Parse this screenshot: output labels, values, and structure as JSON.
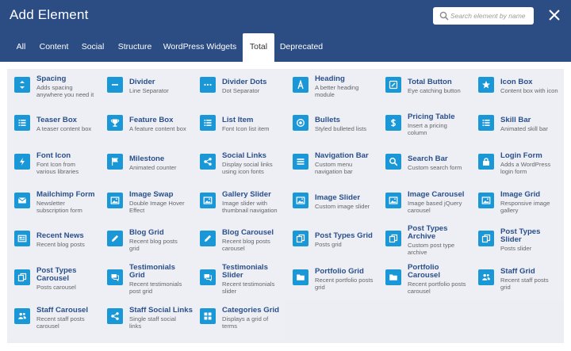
{
  "window": {
    "title": "Add Element"
  },
  "search": {
    "placeholder": "Search element by name"
  },
  "tabs": [
    {
      "label": "All",
      "active": false
    },
    {
      "label": "Content",
      "active": false
    },
    {
      "label": "Social",
      "active": false
    },
    {
      "label": "Structure",
      "active": false
    },
    {
      "label": "WordPress Widgets",
      "active": false
    },
    {
      "label": "Total",
      "active": true
    },
    {
      "label": "Deprecated",
      "active": false
    }
  ],
  "colors": {
    "header": "#2c4c84",
    "accent": "#1a97d6",
    "title_text": "#2a4f8a",
    "card_bg": "#edeff5"
  },
  "elements": [
    {
      "title": [
        "Spacing"
      ],
      "desc": [
        "Adds spacing",
        "anywhere you need it"
      ],
      "icon": "spacing-icon"
    },
    {
      "title": [
        "Divider"
      ],
      "desc": [
        "Line Separator"
      ],
      "icon": "divider-icon"
    },
    {
      "title": [
        "Divider Dots"
      ],
      "desc": [
        "Dot Separator"
      ],
      "icon": "divider-dots-icon"
    },
    {
      "title": [
        "Heading"
      ],
      "desc": [
        "A better heading",
        "module"
      ],
      "icon": "heading-icon"
    },
    {
      "title": [
        "Total Button"
      ],
      "desc": [
        "Eye catching button"
      ],
      "icon": "button-icon"
    },
    {
      "title": [
        "Icon Box"
      ],
      "desc": [
        "Content box with icon"
      ],
      "icon": "star-icon"
    },
    {
      "title": [
        "Teaser Box"
      ],
      "desc": [
        "A teaser content box"
      ],
      "icon": "list-icon"
    },
    {
      "title": [
        "Feature Box"
      ],
      "desc": [
        "A feature content box"
      ],
      "icon": "trophy-icon"
    },
    {
      "title": [
        "List Item"
      ],
      "desc": [
        "Font Icon list item"
      ],
      "icon": "list-icon"
    },
    {
      "title": [
        "Bullets"
      ],
      "desc": [
        "Styled bulleted lists"
      ],
      "icon": "bullet-icon"
    },
    {
      "title": [
        "Pricing Table"
      ],
      "desc": [
        "Insert a pricing",
        "column"
      ],
      "icon": "dollar-icon"
    },
    {
      "title": [
        "Skill Bar"
      ],
      "desc": [
        "Animated skill bar"
      ],
      "icon": "list-icon"
    },
    {
      "title": [
        "Font Icon"
      ],
      "desc": [
        "Font Icon from",
        "various libraries"
      ],
      "icon": "bolt-icon"
    },
    {
      "title": [
        "Milestone"
      ],
      "desc": [
        "Animated counter"
      ],
      "icon": "flag-icon"
    },
    {
      "title": [
        "Social Links"
      ],
      "desc": [
        "Display social links",
        "using icon fonts"
      ],
      "icon": "share-icon"
    },
    {
      "title": [
        "Navigation Bar"
      ],
      "desc": [
        "Custom menu",
        "navigation bar"
      ],
      "icon": "menu-icon"
    },
    {
      "title": [
        "Search Bar"
      ],
      "desc": [
        "Custom search form"
      ],
      "icon": "search-icon"
    },
    {
      "title": [
        "Login Form"
      ],
      "desc": [
        "Adds a WordPress",
        "login form"
      ],
      "icon": "lock-icon"
    },
    {
      "title": [
        "Mailchimp Form"
      ],
      "desc": [
        "Newsletter",
        "subscription form"
      ],
      "icon": "envelope-icon"
    },
    {
      "title": [
        "Image Swap"
      ],
      "desc": [
        "Double Image Hover",
        "Effect"
      ],
      "icon": "image-icon"
    },
    {
      "title": [
        "Gallery Slider"
      ],
      "desc": [
        "Image slider with",
        "thumbnail navigation"
      ],
      "icon": "image-icon"
    },
    {
      "title": [
        "Image Slider"
      ],
      "desc": [
        "Custom image slider"
      ],
      "icon": "image-icon"
    },
    {
      "title": [
        "Image Carousel"
      ],
      "desc": [
        "Image based jQuery",
        "carousel"
      ],
      "icon": "image-icon"
    },
    {
      "title": [
        "Image Grid"
      ],
      "desc": [
        "Responsive image",
        "gallery"
      ],
      "icon": "image-icon"
    },
    {
      "title": [
        "Recent News"
      ],
      "desc": [
        "Recent blog posts"
      ],
      "icon": "newspaper-icon"
    },
    {
      "title": [
        "Blog Grid"
      ],
      "desc": [
        "Recent blog posts",
        "grid"
      ],
      "icon": "pencil-icon"
    },
    {
      "title": [
        "Blog Carousel"
      ],
      "desc": [
        "Recent blog posts",
        "carousel"
      ],
      "icon": "pencil-icon"
    },
    {
      "title": [
        "Post Types Grid"
      ],
      "desc": [
        "Posts grid"
      ],
      "icon": "copy-icon"
    },
    {
      "title": [
        "Post Types",
        "Archive"
      ],
      "desc": [
        "Custom post type",
        "archive"
      ],
      "icon": "copy-icon"
    },
    {
      "title": [
        "Post Types",
        "Slider"
      ],
      "desc": [
        "Posts slider"
      ],
      "icon": "copy-icon"
    },
    {
      "title": [
        "Post Types",
        "Carousel"
      ],
      "desc": [
        "Posts carousel"
      ],
      "icon": "copy-icon"
    },
    {
      "title": [
        "Testimonials",
        "Grid"
      ],
      "desc": [
        "Recent testimonials",
        "post grid"
      ],
      "icon": "comments-icon"
    },
    {
      "title": [
        "Testimonials",
        "Slider"
      ],
      "desc": [
        "Recent testimonials",
        "slider"
      ],
      "icon": "comments-icon"
    },
    {
      "title": [
        "Portfolio Grid"
      ],
      "desc": [
        "Recent portfolio posts",
        "grid"
      ],
      "icon": "folder-icon"
    },
    {
      "title": [
        "Portfolio",
        "Carousel"
      ],
      "desc": [
        "Recent portfolio posts",
        "carousel"
      ],
      "icon": "folder-icon"
    },
    {
      "title": [
        "Staff Grid"
      ],
      "desc": [
        "Recent staff posts",
        "grid"
      ],
      "icon": "users-icon"
    },
    {
      "title": [
        "Staff Carousel"
      ],
      "desc": [
        "Recent staff posts",
        "carousel"
      ],
      "icon": "users-icon"
    },
    {
      "title": [
        "Staff Social Links"
      ],
      "desc": [
        "Single staff social",
        "links"
      ],
      "icon": "share-icon"
    },
    {
      "title": [
        "Categories Grid"
      ],
      "desc": [
        "Displays a grid of",
        "terms"
      ],
      "icon": "grid-icon"
    }
  ]
}
